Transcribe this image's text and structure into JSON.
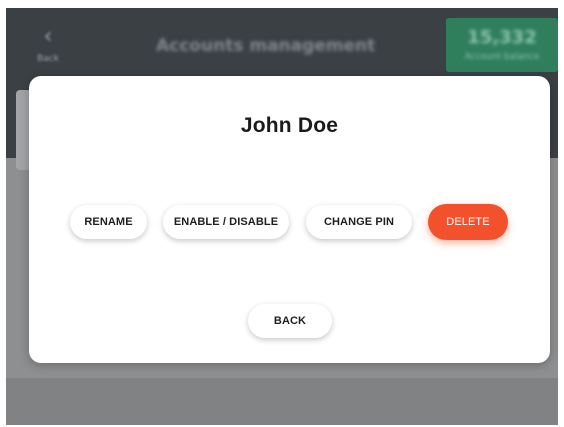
{
  "background": {
    "back_label": "Back",
    "header_title": "Accounts management",
    "balance": {
      "amount": "15,332",
      "subtitle": "Account balance"
    }
  },
  "modal": {
    "title": "John Doe",
    "actions": {
      "rename": "RENAME",
      "enable_disable": "ENABLE / DISABLE",
      "change_pin": "CHANGE PIN",
      "delete": "DELETE"
    },
    "back": "BACK"
  },
  "colors": {
    "delete_accent": "#f2512c",
    "balance_card": "#2f7f5d",
    "header": "#3b4045"
  }
}
